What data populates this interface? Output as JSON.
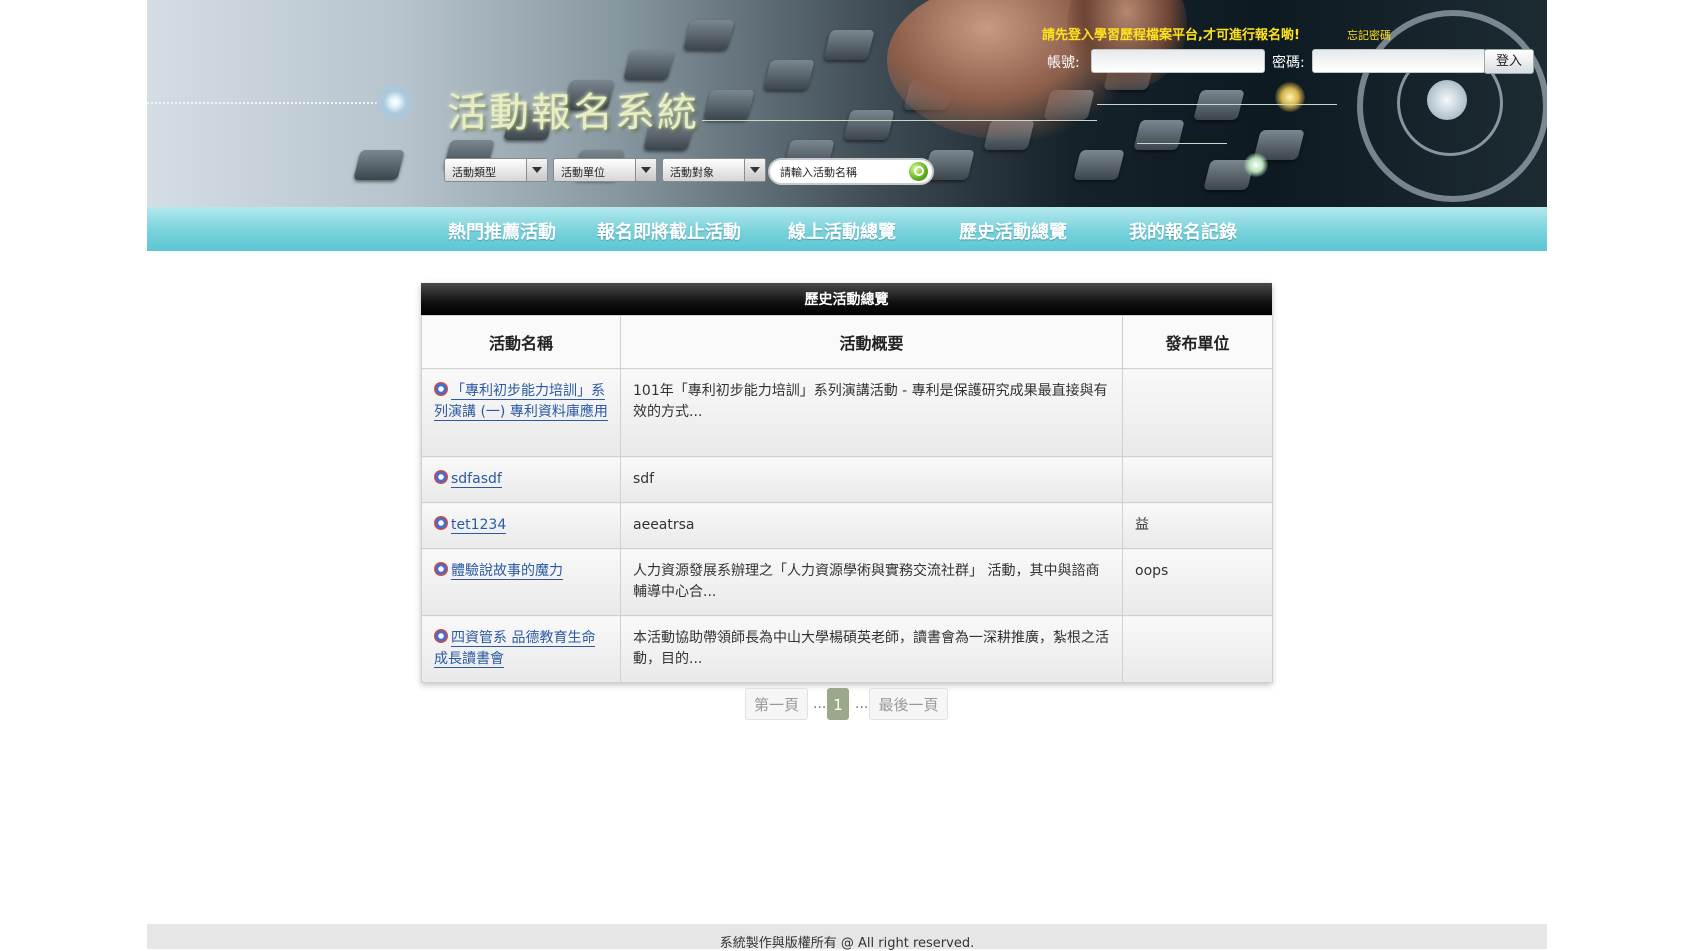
{
  "header": {
    "brand_title": "活動報名系統",
    "login_message": "請先登入學習歷程檔案平台,才可進行報名喲!",
    "forgot_password": "忘記密碼",
    "account_label": "帳號:",
    "password_label": "密碼:",
    "login_button": "登入"
  },
  "filters": {
    "activity_type": "活動類型",
    "activity_unit": "活動單位",
    "activity_target": "活動對象",
    "search_placeholder": "請輸入活動名稱"
  },
  "nav": {
    "items": [
      {
        "label": "熱門推薦活動"
      },
      {
        "label": "報名即將截止活動"
      },
      {
        "label": "線上活動總覽"
      },
      {
        "label": "歷史活動總覽"
      },
      {
        "label": "我的報名記錄"
      }
    ]
  },
  "panel": {
    "title": "歷史活動總覽",
    "columns": [
      "活動名稱",
      "活動概要",
      "發布單位"
    ],
    "rows": [
      {
        "name": "「專利初步能力培訓」系列演講 (一) 專利資料庫應用",
        "summary": "101年「專利初步能力培訓」系列演講活動 - 專利是保護研究成果最直接與有效的方式...",
        "unit": ""
      },
      {
        "name": "sdfasdf",
        "summary": "sdf",
        "unit": ""
      },
      {
        "name": "tet1234",
        "summary": "aeeatrsa",
        "unit": "益"
      },
      {
        "name": "體驗說故事的魔力",
        "summary": "人力資源發展系辦理之「人力資源學術與實務交流社群」 活動，其中與諮商輔導中心合...",
        "unit": "oops"
      },
      {
        "name": "四資管系 品德教育生命成長讀書會",
        "summary": "本活動協助帶領師長為中山大學楊碩英老師，讀書會為一深耕推廣，紮根之活動，目的...",
        "unit": ""
      }
    ]
  },
  "pagination": {
    "first": "第一頁",
    "dots": "...",
    "current": "1",
    "last": "最後一頁"
  },
  "footer": {
    "text": "系統製作與版權所有 @ All right reserved."
  },
  "colors": {
    "nav_bg": "#6fcfd9",
    "link": "#2b5aa2",
    "login_message": "#ffe21d",
    "page_active": "#9aa98a"
  }
}
